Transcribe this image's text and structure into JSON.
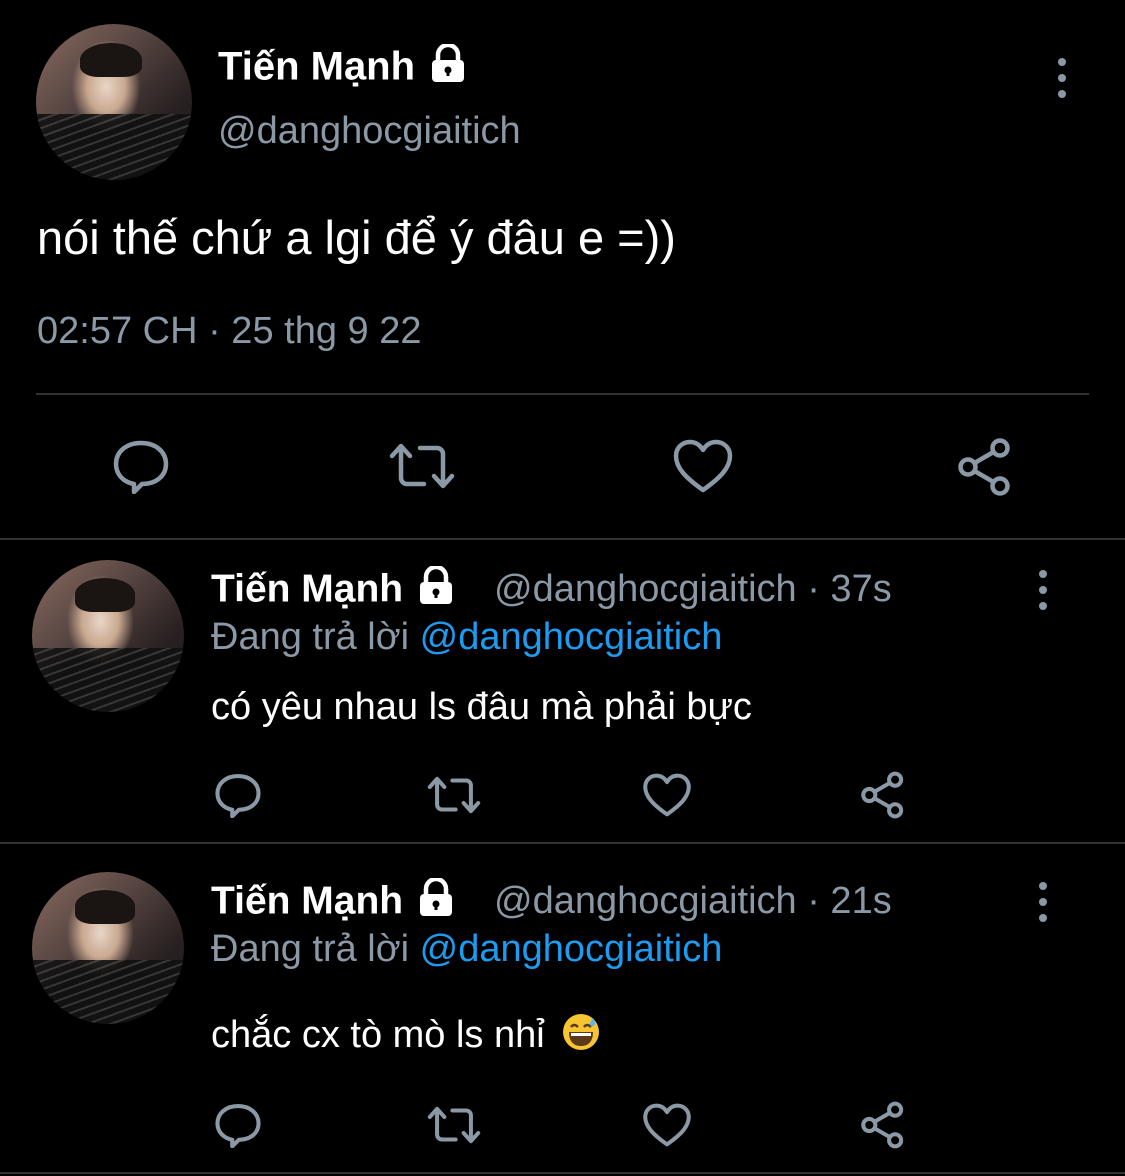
{
  "main_tweet": {
    "display_name": "Tiến Mạnh",
    "handle": "@danghocgiaitich",
    "text": "nói thế chứ a lgi để ý đâu e =))",
    "timestamp": "02:57 CH · 25 thg 9 22"
  },
  "replies": [
    {
      "display_name": "Tiến Mạnh",
      "handle_time": "@danghocgiaitich · 37s",
      "replying_label": "Đang trả lời",
      "replying_to": "@danghocgiaitich",
      "text": "có yêu nhau ls đâu mà phải bực"
    },
    {
      "display_name": "Tiến Mạnh",
      "handle_time": "@danghocgiaitich · 21s",
      "replying_label": "Đang trả lời",
      "replying_to": "@danghocgiaitich",
      "text": "chắc cx tò mò ls nhỉ"
    }
  ],
  "icons": {
    "reply": "reply-icon",
    "retweet": "retweet-icon",
    "like": "heart-icon",
    "share": "share-icon",
    "more": "more-vertical-icon",
    "protected": "lock-icon",
    "emoji": "grinning-sweat-emoji"
  },
  "colors": {
    "background": "#000000",
    "text": "#ffffff",
    "muted": "#8b98a5",
    "link": "#1d9bf0",
    "divider": "#2f3336"
  }
}
